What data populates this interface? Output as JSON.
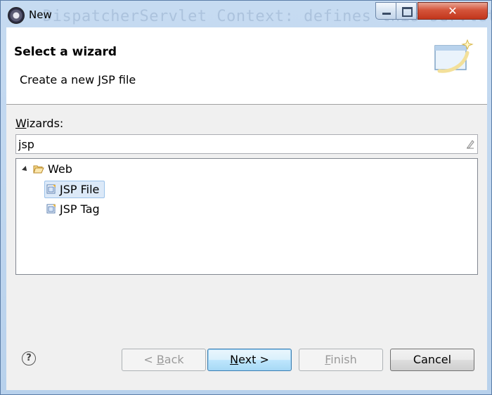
{
  "window": {
    "title": "New",
    "background_text": "DispatcherServlet Context: defines this servlet"
  },
  "header": {
    "title": "Select a wizard",
    "description": "Create a new JSP file"
  },
  "wizards": {
    "label_prefix": "W",
    "label_rest": "izards:",
    "filter_value": "jsp"
  },
  "tree": {
    "folder": {
      "label": "Web",
      "icon": "folder-open-icon",
      "expanded": true
    },
    "items": [
      {
        "label": "JSP File",
        "icon": "jsp-file-icon",
        "selected": true
      },
      {
        "label": "JSP Tag",
        "icon": "jsp-tag-icon",
        "selected": false
      }
    ]
  },
  "buttons": {
    "back_prefix": "< ",
    "back_mnemonic": "B",
    "back_rest": "ack",
    "next_mnemonic": "N",
    "next_rest": "ext >",
    "finish_mnemonic": "F",
    "finish_rest": "inish",
    "cancel": "Cancel",
    "help_glyph": "?"
  },
  "colors": {
    "selection": "#dce9f8",
    "default_button_border": "#3c7fb1",
    "close_button": "#c2361c"
  }
}
